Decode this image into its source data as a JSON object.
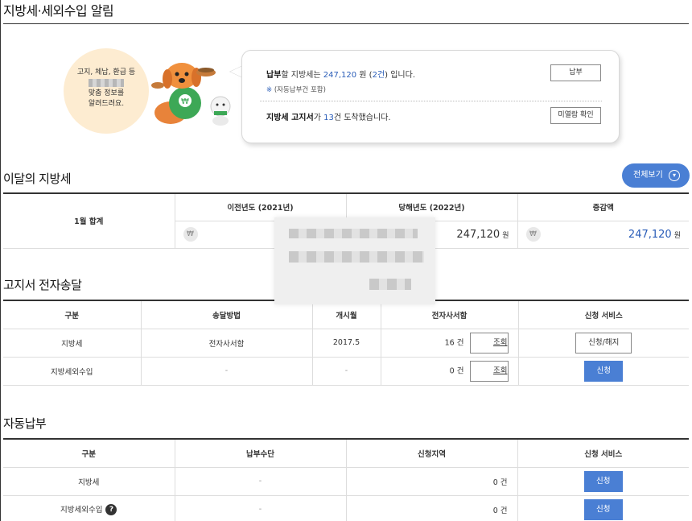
{
  "header": {
    "title": "지방세·세외수입 알림"
  },
  "notice": {
    "circle_line1": "고지, 체납, 환급 등",
    "circle_line3": "맞춤 정보를",
    "circle_line4": "알려드려요.",
    "pay_prefix": "납부",
    "pay_mid": "할 지방세는 ",
    "pay_amount": "247,120",
    "pay_unit": " 원 (",
    "pay_count": "2건",
    "pay_suffix": ") 입니다.",
    "pay_note_mark": "※",
    "pay_note": " (자동납부건 포함)",
    "pay_button": "납부",
    "bill_prefix": "지방세 고지서",
    "bill_mid": "가 ",
    "bill_count": "13",
    "bill_suffix": "건 도착했습니다.",
    "bill_button": "미열람 확인"
  },
  "monthly": {
    "title": "이달의 지방세",
    "view_all": "전체보기",
    "row_label": "1월 합계",
    "col_prev": "이전년도 (2021년)",
    "col_curr": "당해년도 (2022년)",
    "col_diff": "증감액",
    "won_symbol": "₩",
    "curr_amount": "247,120",
    "diff_amount": "247,120",
    "unit": "원"
  },
  "ebill": {
    "title": "고지서 전자송달",
    "headers": [
      "구분",
      "송달방법",
      "개시월",
      "전자사서함",
      "신청 서비스"
    ],
    "rows": [
      {
        "type": "지방세",
        "method": "전자사서함",
        "start": "2017.5",
        "count": "16 건",
        "view": "조회",
        "service": "신청/해지"
      },
      {
        "type": "지방세외수입",
        "method": "-",
        "start": "-",
        "count": "0 건",
        "view": "조회",
        "service": "신청"
      }
    ]
  },
  "autopay": {
    "title": "자동납부",
    "headers": [
      "구분",
      "납부수단",
      "신청지역",
      "신청 서비스"
    ],
    "rows": [
      {
        "type": "지방세",
        "means": "-",
        "count": "0 건",
        "service": "신청"
      },
      {
        "type": "지방세외수입",
        "means": "-",
        "count": "0 건",
        "service": "신청",
        "help": "?"
      }
    ]
  },
  "colors": {
    "accent": "#4a7fd4",
    "link_blue": "#2a5db8",
    "circle_bg": "#fdecd1"
  }
}
